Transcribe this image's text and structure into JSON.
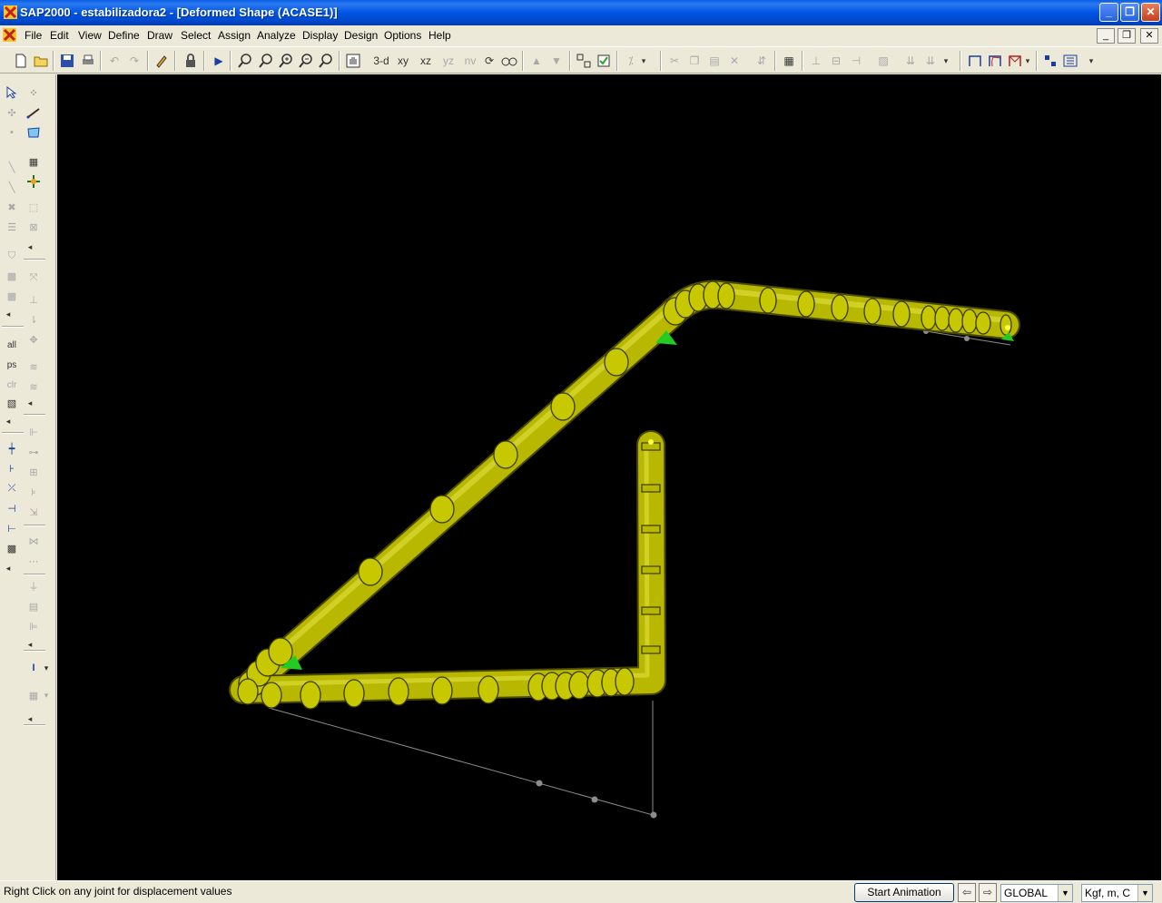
{
  "window": {
    "title": "SAP2000 - estabilizadora2 - [Deformed Shape (ACASE1)]",
    "minimize": "_",
    "restore": "❐",
    "close": "✕"
  },
  "menu": {
    "items": [
      "File",
      "Edit",
      "View",
      "Define",
      "Draw",
      "Select",
      "Assign",
      "Analyze",
      "Display",
      "Design",
      "Options",
      "Help"
    ],
    "mdi": {
      "minimize": "_",
      "restore": "❐",
      "close": "✕"
    }
  },
  "toolbar": {
    "view_3d": "3-d",
    "view_xy": "xy",
    "view_xz": "xz",
    "view_yz": "yz",
    "view_nv": "nv"
  },
  "sidepanel": {
    "select_all": "all",
    "select_previous": "ps",
    "clear_selection": "clr"
  },
  "viewport": {
    "background": "#000000",
    "frame_color": "#c8c800",
    "support_color": "#22cc22",
    "undeformed_color": "#8c8c8c"
  },
  "status": {
    "message": "Right Click on any joint for displacement values",
    "animation_button": "Start Animation",
    "coord_system": "GLOBAL",
    "units": "Kgf, m, C"
  }
}
